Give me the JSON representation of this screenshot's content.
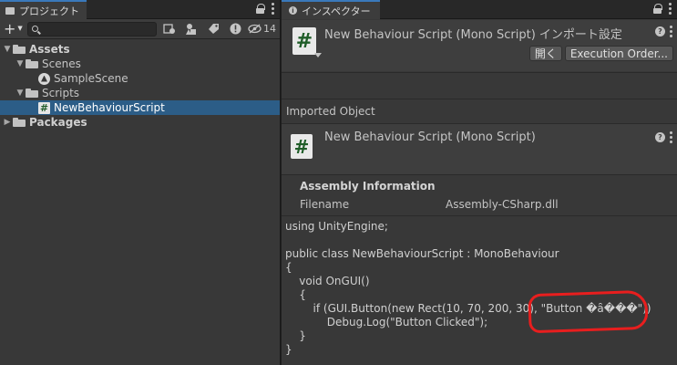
{
  "project": {
    "tab_title": "プロジェクト",
    "search": {
      "value": "",
      "placeholder": ""
    },
    "hidden_count": "14",
    "tree": [
      {
        "label": "Assets",
        "kind": "folder",
        "depth": 0,
        "expanded": true,
        "bold": true
      },
      {
        "label": "Scenes",
        "kind": "folder",
        "depth": 1,
        "expanded": true,
        "bold": false
      },
      {
        "label": "SampleScene",
        "kind": "scene",
        "depth": 2,
        "bold": false
      },
      {
        "label": "Scripts",
        "kind": "folder",
        "depth": 1,
        "expanded": true,
        "bold": false
      },
      {
        "label": "NewBehaviourScript",
        "kind": "script",
        "depth": 2,
        "selected": true,
        "bold": false
      },
      {
        "label": "Packages",
        "kind": "folder",
        "depth": 0,
        "expanded": false,
        "bold": true
      }
    ]
  },
  "inspector": {
    "tab_title": "インスペクター",
    "header_title": "New Behaviour Script (Mono Script) インポート設定",
    "open_button": "開く",
    "execution_order_button": "Execution Order...",
    "imported_object_label": "Imported Object",
    "object_title": "New Behaviour Script (Mono Script)",
    "assembly": {
      "heading": "Assembly Information",
      "filename_label": "Filename",
      "filename_value": "Assembly-CSharp.dll"
    },
    "code_lines": [
      "using UnityEngine;",
      "",
      "public class NewBehaviourScript : MonoBehaviour",
      "{",
      "    void OnGUI()",
      "    {",
      "        if (GUI.Button(new Rect(10, 70, 200, 30), \"Button �ȃ���\"))",
      "            Debug.Log(\"Button Clicked\");",
      "    }",
      "}"
    ]
  },
  "colors": {
    "selection": "#2c5d87",
    "annotation": "#e81e1e",
    "tab_accent": "#3a79bb"
  }
}
